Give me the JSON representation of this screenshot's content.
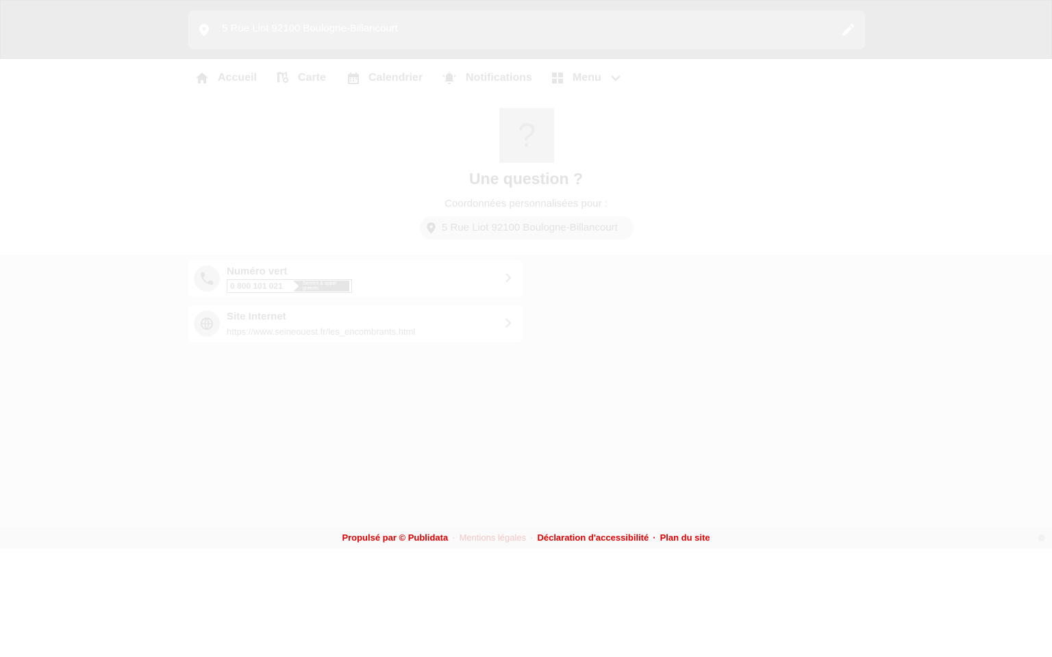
{
  "header": {
    "address": "5 Rue Liot 92100 Boulogne-Billancourt",
    "pin_icon": "location-pin-icon",
    "edit_icon": "pencil-icon"
  },
  "nav": {
    "items": [
      {
        "label": "Accueil",
        "icon": "home-icon"
      },
      {
        "label": "Carte",
        "icon": "map-icon"
      },
      {
        "label": "Calendrier",
        "icon": "calendar-icon"
      },
      {
        "label": "Notifications",
        "icon": "bell-alert-icon"
      },
      {
        "label": "Menu",
        "icon": "grid-icon"
      }
    ]
  },
  "hero": {
    "question_mark": "?",
    "title": "Une question ?",
    "subtitle": "Coordonnées personnalisées pour :",
    "address": "5 Rue Liot 92100 Boulogne-Billancourt"
  },
  "cards": [
    {
      "title": "Numéro vert",
      "phone": "0 800 101 021",
      "tag": "Service & appel gratuits",
      "icon": "phone-icon"
    },
    {
      "title": "Site Internet",
      "url": "https://www.seineouest.fr/les_encombrants.html",
      "icon": "globe-icon"
    }
  ],
  "footer": {
    "left": "Propulsé par © Publidata",
    "middle": "Mentions légales",
    "right": "Déclaration d'accessibilité",
    "far_right": "Plan du site"
  },
  "colors": {
    "accent_red": "#e00000",
    "faded_text": "#e6e6e6"
  }
}
